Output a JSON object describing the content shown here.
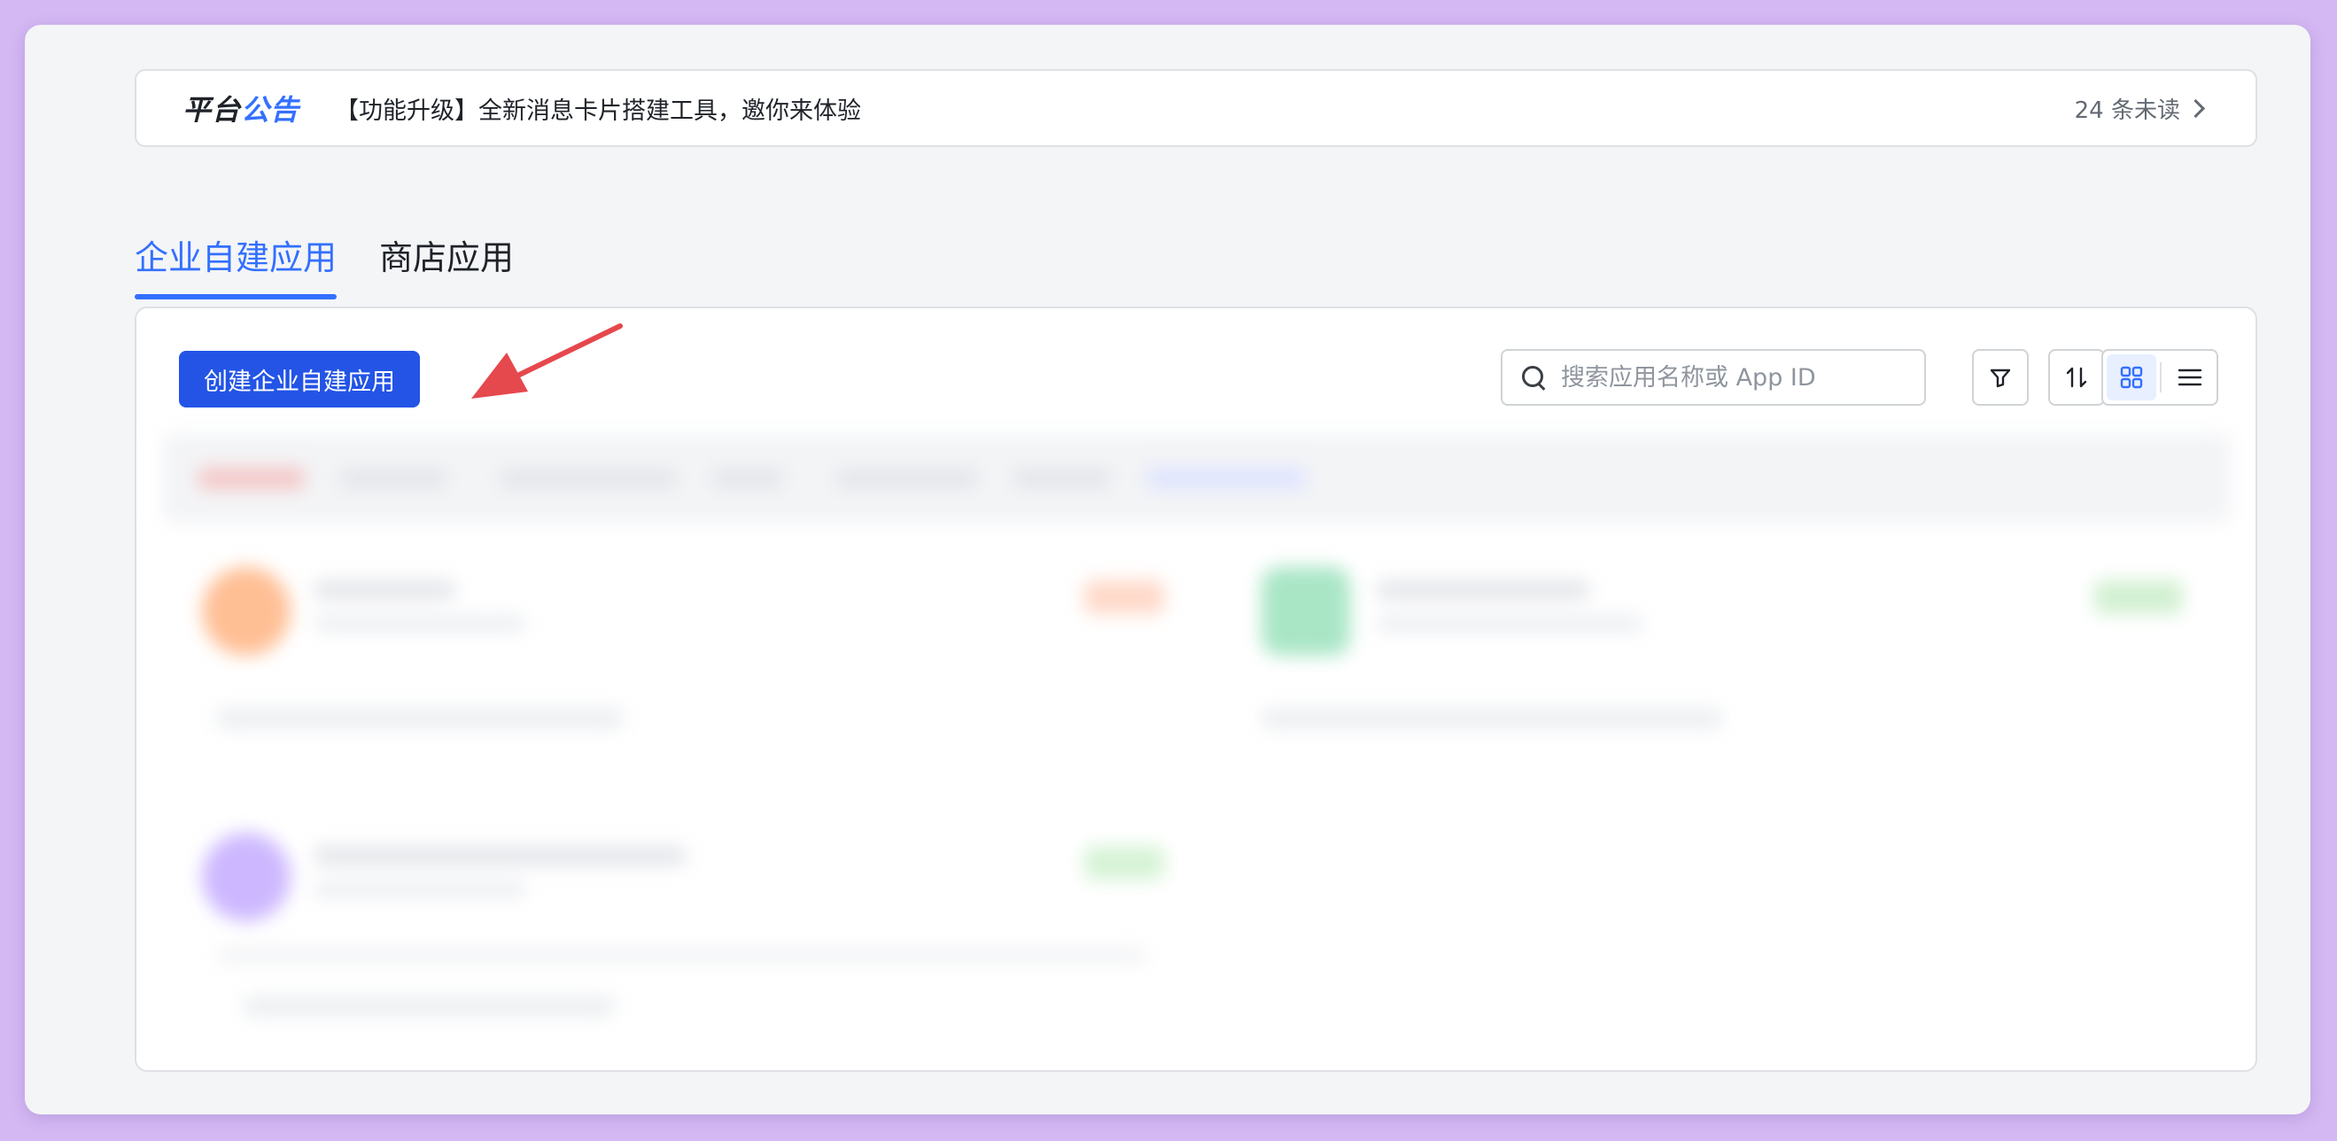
{
  "notice": {
    "logo_part1": "平台",
    "logo_part2": "公告",
    "text": "【功能升级】全新消息卡片搭建工具，邀你来体验",
    "unread": "24 条未读"
  },
  "tabs": [
    {
      "label": "企业自建应用",
      "active": true
    },
    {
      "label": "商店应用",
      "active": false
    }
  ],
  "toolbar": {
    "create_label": "创建企业自建应用",
    "search_placeholder": "搜索应用名称或 App ID"
  },
  "colors": {
    "accent": "#3370ff",
    "button": "#2354e6",
    "annotation_arrow": "#e5484d",
    "background": "#d4b8f3"
  }
}
